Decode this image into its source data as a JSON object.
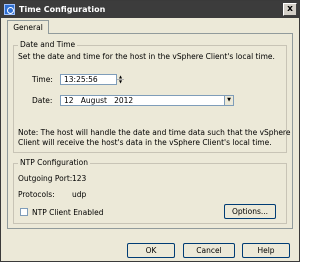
{
  "window": {
    "title": "Time Configuration",
    "close_glyph": "x"
  },
  "tabs": [
    {
      "label": "General"
    }
  ],
  "date_time_group": {
    "title": "Date and Time",
    "description": "Set the date and time for the host in the vSphere Client's local time.",
    "time_label": "Time:",
    "time_value": "13:25:56",
    "date_label": "Date:",
    "date_value": "12   August   2012",
    "note_line1": "Note: The host will handle the date and time data such that the vSphere",
    "note_line2": "Client will receive the host's data in the vSphere Client's local time."
  },
  "ntp_group": {
    "title": "NTP Configuration",
    "outgoing_port_label": "Outgoing Port:",
    "outgoing_port_value": "123",
    "protocols_label": "Protocols:",
    "protocols_value": "udp",
    "ntp_enabled_label": "NTP Client Enabled",
    "ntp_enabled_checked": false,
    "options_button": "Options..."
  },
  "footer": {
    "ok": "OK",
    "cancel": "Cancel",
    "help": "Help"
  },
  "icons": {
    "spin_up": "▲",
    "spin_down": "▼",
    "dropdown": "▼"
  },
  "colors": {
    "titlebar": "#3c3c3c",
    "dialog_bg": "#ece9d8",
    "field_border": "#7f9db9"
  }
}
